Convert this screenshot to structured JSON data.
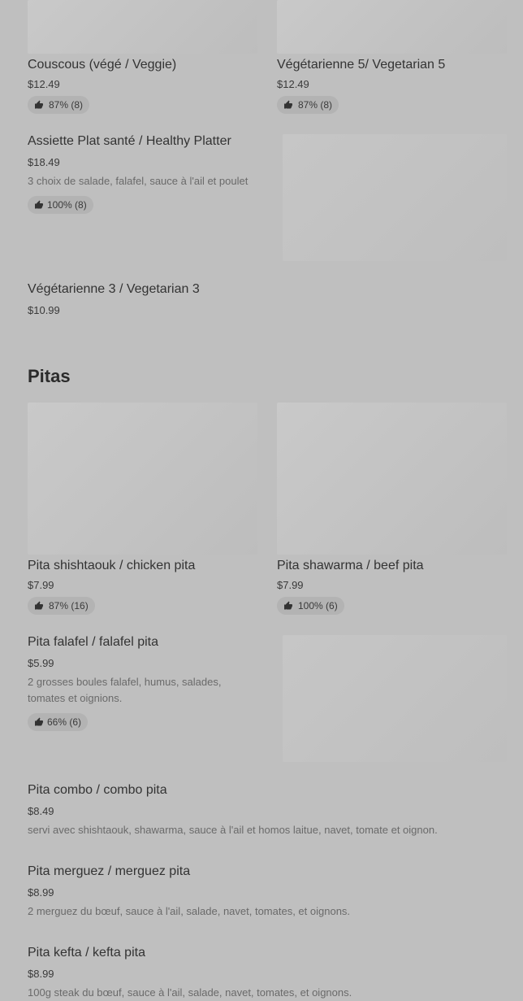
{
  "sections": [
    {
      "title": "",
      "grid_items": [
        {
          "name": "Couscous (végé / Veggie)",
          "price": "$12.49",
          "rating": "87% (8)"
        },
        {
          "name": "Végétarienne 5/ Vegetarian 5",
          "price": "$12.49",
          "rating": "87% (8)"
        }
      ],
      "list_items": [
        {
          "name": "Assiette Plat santé / Healthy Platter",
          "price": "$18.49",
          "description": "3 choix de salade, falafel, sauce à l'ail et poulet",
          "rating": "100% (8)"
        },
        {
          "name": "Végétarienne 3 / Vegetarian 3",
          "price": "$10.99"
        }
      ]
    },
    {
      "title": "Pitas",
      "grid_items": [
        {
          "name": "Pita shishtaouk / chicken pita",
          "price": "$7.99",
          "rating": "87% (16)"
        },
        {
          "name": "Pita shawarma / beef pita",
          "price": "$7.99",
          "rating": "100% (6)"
        }
      ],
      "list_items": [
        {
          "name": "Pita falafel / falafel pita",
          "price": "$5.99",
          "description_line1": "2 grosses boules falafel, humus, salades,",
          "description_line2": "tomates et oignions.",
          "rating": "66% (6)"
        },
        {
          "name": "Pita combo / combo pita",
          "price": "$8.49",
          "description": "servi avec shishtaouk, shawarma, sauce à l'ail et homos laitue, navet, tomate et oignon."
        },
        {
          "name": "Pita merguez / merguez pita",
          "price": "$8.99",
          "description": "2 merguez du bœuf, sauce à l'ail, salade, navet, tomates, et oignons."
        },
        {
          "name": "Pita kefta / kefta pita",
          "price": "$8.99",
          "description": "100g steak du bœuf, sauce à l'ail, salade, navet, tomates, et oignons."
        }
      ]
    }
  ],
  "icons": {
    "rating": "thumbs-up-icon"
  }
}
